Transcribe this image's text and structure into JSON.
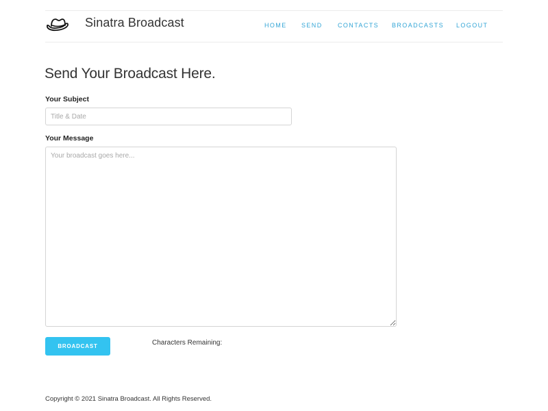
{
  "header": {
    "brand_name": "Sinatra Broadcast",
    "logo_icon": "fedora-hat-icon",
    "nav": {
      "home": "HOME",
      "send": "SEND",
      "contacts": "CONTACTS",
      "broadcasts": "BROADCASTS",
      "logout": "LOGOUT"
    }
  },
  "main": {
    "title": "Send Your Broadcast Here.",
    "subject": {
      "label": "Your Subject",
      "placeholder": "Title & Date",
      "value": ""
    },
    "message": {
      "label": "Your Message",
      "placeholder": "Your broadcast goes here...",
      "value": ""
    },
    "broadcast_button": "BROADCAST",
    "characters_remaining_label": "Characters Remaining:"
  },
  "footer": {
    "copyright": "Copyright © 2021 Sinatra Broadcast. All Rights Reserved."
  },
  "colors": {
    "accent": "#33c3f0",
    "nav_link": "#33a5d6",
    "text": "#333333",
    "border": "#d4d4d4"
  }
}
